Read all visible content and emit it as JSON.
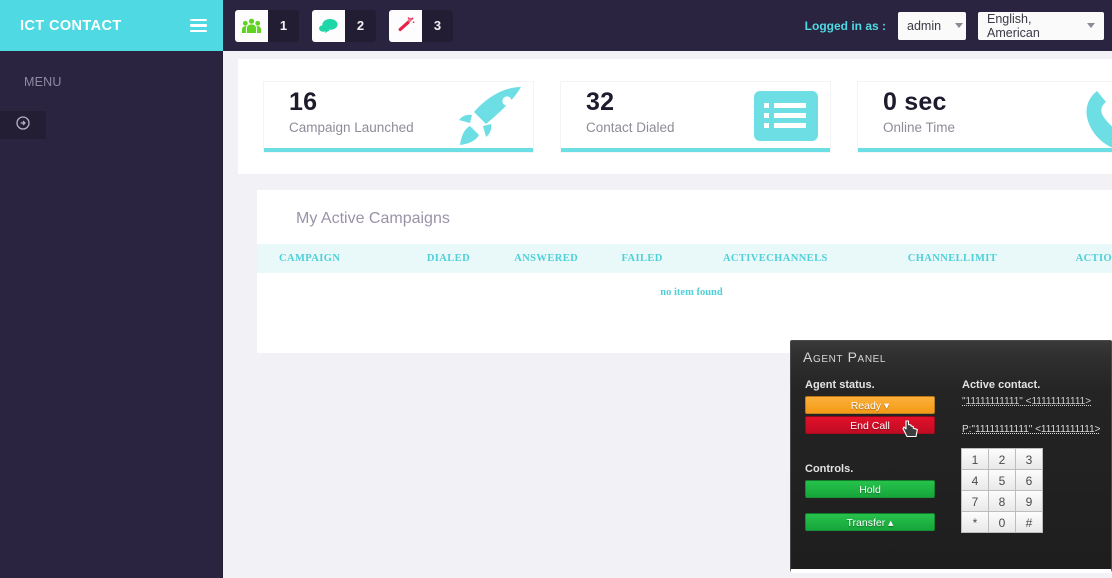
{
  "brand": {
    "title": "ICT CONTACT",
    "menu_icon": "hamburger-icon"
  },
  "topbar": {
    "badges": [
      {
        "icon": "users-icon",
        "count": "1",
        "color": "#5fd321"
      },
      {
        "icon": "chat-bubble-icon",
        "count": "2",
        "color": "#1fd6a8"
      },
      {
        "icon": "magic-wand-icon",
        "count": "3",
        "color": "#e8214b"
      }
    ],
    "logged_in_label": "Logged in as :",
    "user_select": "admin",
    "language_select": "English, American"
  },
  "sidebar": {
    "menu_label": "MENU",
    "toggle_icon": "circle-arrow-icon"
  },
  "cards": [
    {
      "value": "16",
      "label": "Campaign Launched",
      "icon": "rocket-icon"
    },
    {
      "value": "32",
      "label": "Contact Dialed",
      "icon": "list-icon"
    },
    {
      "value": "0 sec",
      "label": "Online Time",
      "icon": "phone-icon"
    }
  ],
  "campaigns": {
    "title": "My Active Campaigns",
    "columns": [
      "CAMPAIGN",
      "DIALED",
      "ANSWERED",
      "FAILED",
      "ACTIVECHANNELS",
      "CHANNELLIMIT",
      "ACTION"
    ],
    "empty_message": "no item found"
  },
  "agent_panel": {
    "title": "Agent Panel",
    "status_label": "Agent status.",
    "status_button": "Ready",
    "end_call_button": "End Call",
    "controls_label": "Controls.",
    "hold_button": "Hold",
    "transfer_button": "Transfer",
    "active_contact_label": "Active contact.",
    "contact_line_1": "\"11111111111\" <11111111111>",
    "contact_line_2": "P:\"11111111111\" <11111111111>",
    "keypad": [
      [
        "1",
        "2",
        "3"
      ],
      [
        "4",
        "5",
        "6"
      ],
      [
        "7",
        "8",
        "9"
      ],
      [
        "*",
        "0",
        "#"
      ]
    ]
  },
  "colors": {
    "brand": "#4fd9e2",
    "dark": "#2b2440",
    "accent_teal": "#6ddfe4"
  }
}
